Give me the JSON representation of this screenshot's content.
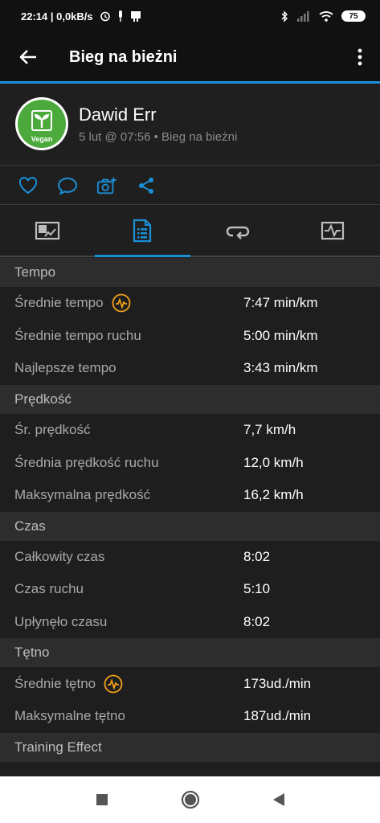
{
  "status_bar": {
    "time_info": "22:14 | 0,0kB/s",
    "battery": "75"
  },
  "appbar": {
    "title": "Bieg na bieżni",
    "back_icon": "arrow-left-icon",
    "menu_icon": "more-vertical-icon"
  },
  "profile": {
    "name": "Dawid Err",
    "meta": "5 lut @ 07:56 • Bieg na bieżni",
    "avatar_text": "Vegan"
  },
  "actions": [
    "heart-icon",
    "comment-icon",
    "camera-add-icon",
    "share-icon"
  ],
  "tabs": [
    "overview-icon",
    "details-icon",
    "laps-icon",
    "charts-icon"
  ],
  "sections": [
    {
      "title": "Tempo",
      "rows": [
        {
          "label": "Średnie tempo",
          "value": "7:47 min/km",
          "icon": true
        },
        {
          "label": "Średnie tempo ruchu",
          "value": "5:00 min/km"
        },
        {
          "label": "Najlepsze tempo",
          "value": "3:43 min/km"
        }
      ]
    },
    {
      "title": "Prędkość",
      "rows": [
        {
          "label": "Śr. prędkość",
          "value": "7,7 km/h"
        },
        {
          "label": "Średnia prędkość ruchu",
          "value": "12,0 km/h"
        },
        {
          "label": "Maksymalna prędkość",
          "value": "16,2 km/h"
        }
      ]
    },
    {
      "title": "Czas",
      "rows": [
        {
          "label": "Całkowity czas",
          "value": "8:02"
        },
        {
          "label": "Czas ruchu",
          "value": "5:10"
        },
        {
          "label": "Upłynęło czasu",
          "value": "8:02"
        }
      ]
    },
    {
      "title": "Tętno",
      "rows": [
        {
          "label": "Średnie tętno",
          "value": "173ud./min",
          "icon": true
        },
        {
          "label": "Maksymalne tętno",
          "value": "187ud./min"
        }
      ]
    },
    {
      "title": "Training Effect",
      "rows": []
    }
  ],
  "colors": {
    "accent": "#1a8fd6",
    "pulse_icon": "#f0a019",
    "avatar_green": "#4caa3c"
  }
}
